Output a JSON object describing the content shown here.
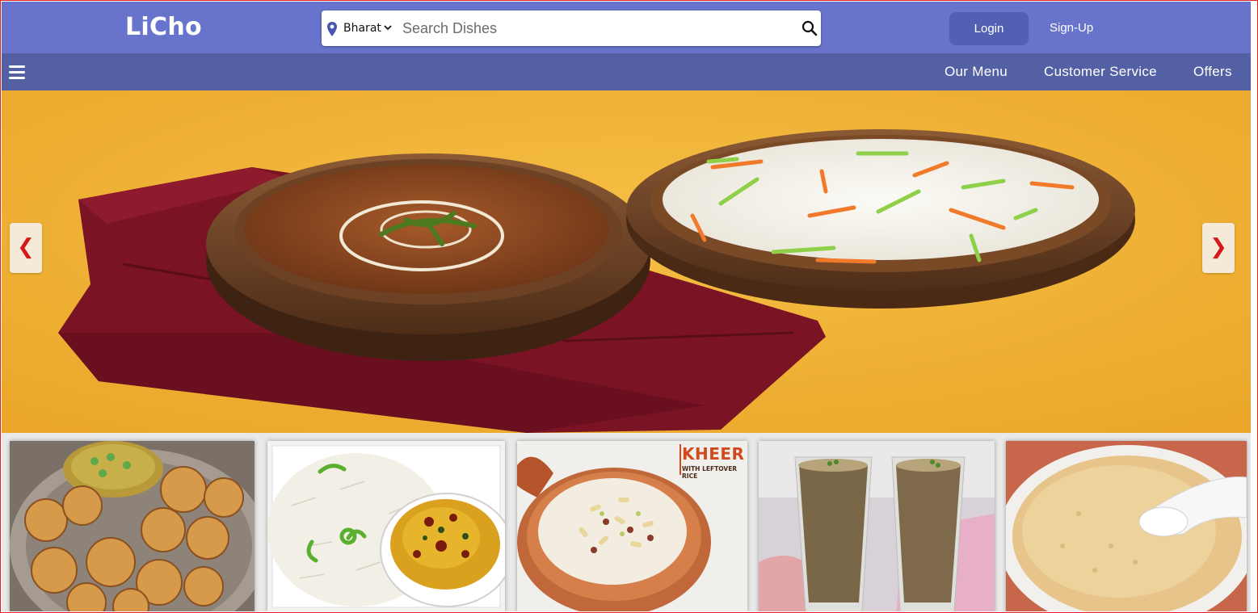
{
  "header": {
    "logo": "LiCho",
    "location": "Bharat",
    "search_placeholder": "Search Dishes",
    "login_label": "Login",
    "signup_label": "Sign-Up"
  },
  "nav": {
    "items": [
      "Our Menu",
      "Customer Service",
      "Offers"
    ]
  },
  "carousel": {
    "prev_label": "❮",
    "next_label": "❯"
  },
  "thumbnails": [
    {
      "label": "KHEER",
      "sublabel": "WITH LEFTOVER RICE"
    }
  ],
  "colors": {
    "topbar": "#6874cc",
    "navbar": "#5460a4",
    "login_button": "#5260b4",
    "arrow": "#d51818"
  },
  "icons": {
    "location": "location-pin-icon",
    "search": "search-icon",
    "menu": "hamburger-menu-icon"
  }
}
